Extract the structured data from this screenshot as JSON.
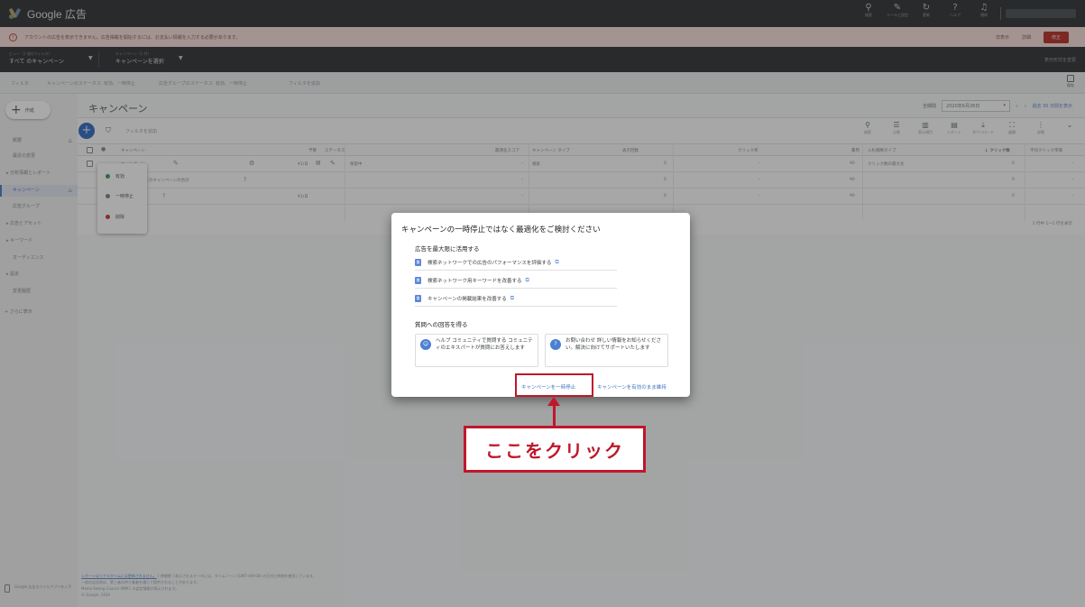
{
  "app": {
    "title": "Google 広告"
  },
  "top_tools": [
    {
      "icon": "search-icon",
      "glyph": "⚲",
      "label": "検索"
    },
    {
      "icon": "wrench-icon",
      "glyph": "✎",
      "label": "ツールと設定"
    },
    {
      "icon": "refresh-icon",
      "glyph": "↻",
      "label": "更新"
    },
    {
      "icon": "help-icon",
      "glyph": "?",
      "label": "ヘルプ"
    },
    {
      "icon": "bell-icon",
      "glyph": "♫",
      "label": "通知"
    }
  ],
  "alert": {
    "text": "アカウントの広告を表示できません。広告掲載を開始するには、お支払い情報を入力する必要があります。",
    "dismiss": "非表示",
    "details": "詳細",
    "fix": "修正"
  },
  "selectors": {
    "view_small": "ビュー（1 個のフィルタ）",
    "view_label": "すべて のキャンペーン",
    "campaign_small": "キャンペーン（1 件）",
    "campaign_label": "キャンペーンを選択",
    "right": "表示形式を変更"
  },
  "filterbar": {
    "label": "フィルタ",
    "items": [
      "キャンペーンのステータス: 有効、一時停止",
      "広告グループのステータス: 有効、一時停止",
      "フィルタを追加"
    ],
    "save": "保存"
  },
  "nav": {
    "create": "作成",
    "items": [
      "概要",
      "最近の変更",
      "分析情報とレポート",
      "キャンペーン",
      "広告グループ",
      "広告とアセット",
      "キーワード",
      "オーディエンス",
      "設定",
      "変更履歴",
      "さらに表示"
    ],
    "footer": "Google 広告モバイルアプリを入手"
  },
  "main": {
    "title": "キャンペーン",
    "date_label": "全期間",
    "date_value": "2020年6月26日",
    "date_link": "過去 30 日間を表示",
    "add_filter": "フィルタを追加",
    "tools": [
      {
        "icon": "search-icon",
        "glyph": "⚲",
        "label": "検索"
      },
      {
        "icon": "segment-icon",
        "glyph": "☰",
        "label": "分割"
      },
      {
        "icon": "columns-icon",
        "glyph": "▥",
        "label": "表示項目"
      },
      {
        "icon": "reports-icon",
        "glyph": "▤",
        "label": "レポート"
      },
      {
        "icon": "download-icon",
        "glyph": "⤓",
        "label": "ダウンロード"
      },
      {
        "icon": "expand-icon",
        "glyph": "⛶",
        "label": "展開"
      },
      {
        "icon": "more-icon",
        "glyph": "⋮",
        "label": "詳細"
      }
    ],
    "headers": [
      "キャンペーン",
      "予算",
      "ステータス",
      "最適化スコア",
      "キャンペーン タイプ",
      "表示回数",
      "クリック率",
      "費用",
      "入札戦略タイプ",
      "↓ クリック数",
      "平均クリック単価"
    ],
    "rows": [
      {
        "name": "キャンペーン",
        "budget": "¥1/日",
        "status": "保留中",
        "score": "–",
        "type": "検索",
        "impr": "0",
        "ctr": "–",
        "cost": "¥0",
        "bid": "クリック数の最大化",
        "clicks": "0",
        "cpc": "–"
      },
      {
        "name": "ビューのすべてのキャンペーンの合計",
        "score": "–",
        "impr": "0",
        "ctr": "–",
        "cost": "¥0",
        "clicks": "0",
        "cpc": "–"
      },
      {
        "name": "キャンペーン",
        "budget": "¥1/日",
        "score": "–",
        "impr": "0",
        "ctr": "–",
        "cost": "¥0",
        "clicks": "0",
        "cpc": "–"
      }
    ],
    "pager": "1 行中 1〜1 行を表示"
  },
  "status_menu": [
    "有効",
    "一時停止",
    "削除"
  ],
  "footer": {
    "link": "レポートはリアルタイムには更新されません。",
    "line1": "[ 時間帯 ] 表示されるデータには、タイムゾーン (GMT+09:00) の日付と時刻を使用しています。",
    "line2": "一部の広告枠は、第三者の仲介業者を通じて提供されることがあります。",
    "line3": "Media Rating Council (MRC) の認定情報が表示されます。",
    "copyright": "© Google, 2020"
  },
  "modal": {
    "title": "キャンペーンの一時停止ではなく最適化をご検討ください",
    "section1": "広告を最大限に活用する",
    "links": [
      "検索ネットワークでの広告のパフォーマンスを評価する",
      "検索ネットワーク用キーワードを改善する",
      "キャンペーンの掲載結果を改善する"
    ],
    "section2": "質問への回答を得る",
    "cards": [
      {
        "icon": "community-icon",
        "glyph": "☺",
        "text": "ヘルプ コミュニティで質問する コミュニティのエキスパートが質問にお答えします"
      },
      {
        "icon": "contact-icon",
        "glyph": "?",
        "text": "お問い合わせ 詳しい情報をお知らせください。解決に向けてサポートいたします"
      }
    ],
    "pause_button": "キャンペーンを一時停止",
    "keep_button": "キャンペーンを有効のまま維持"
  },
  "annotation": {
    "callout": "ここをクリック",
    "color": "#c0172b"
  }
}
